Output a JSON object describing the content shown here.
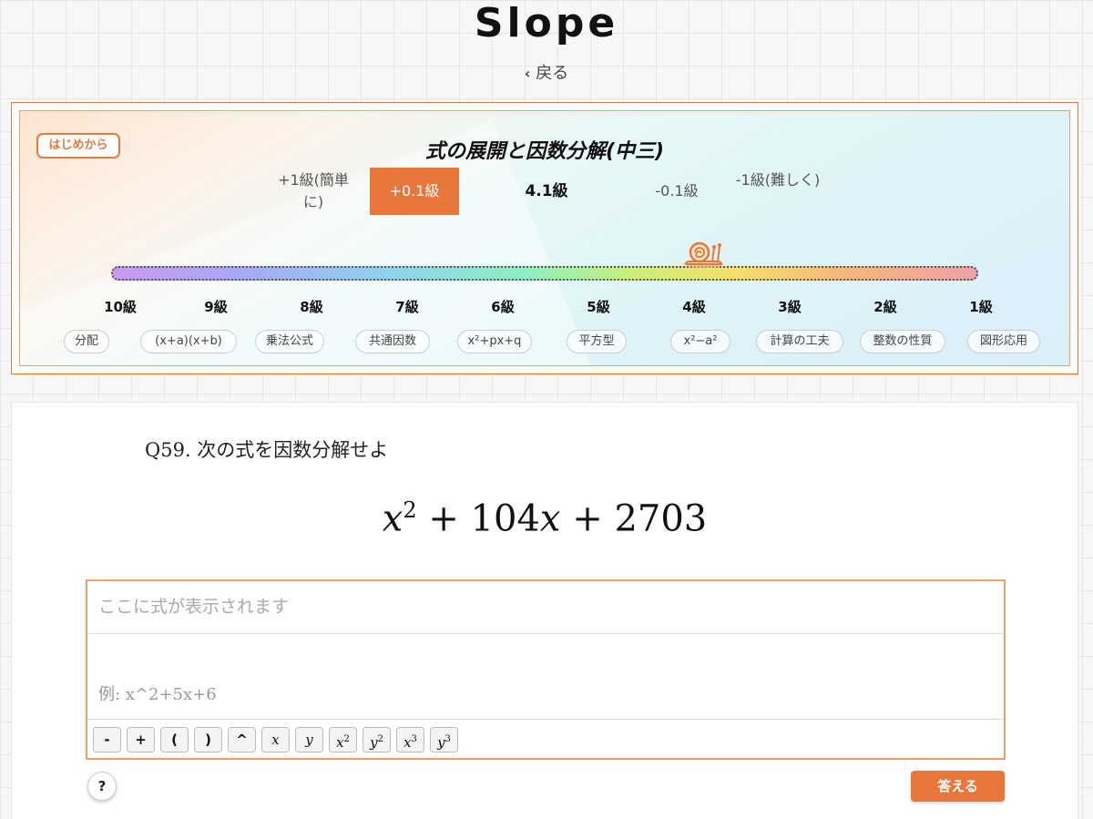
{
  "app": {
    "title": "Slope",
    "back_label": "戻る"
  },
  "panel": {
    "restart_label": "はじめから",
    "unit_title": "式の展開と因数分解(中三)",
    "steps": {
      "plus1": "+1級(簡単に)",
      "plus01": "+0.1級",
      "current": "4.1級",
      "minus01": "-0.1級",
      "minus1": "-1級(難しく)"
    },
    "current_level": 4.1,
    "levels": [
      "10級",
      "9級",
      "8級",
      "7級",
      "6級",
      "5級",
      "4級",
      "3級",
      "2級",
      "1級"
    ],
    "topics": [
      "分配",
      "(x+a)(x+b)",
      "乗法公式",
      "共通因数",
      "x²+px+q",
      "平方型",
      "x²−a²",
      "計算の工夫",
      "整数の性質",
      "図形応用"
    ]
  },
  "question": {
    "label": "Q59. 次の式を因数分解せよ",
    "expr": {
      "term1_var": "x",
      "term1_exp": "2",
      "op1": "+",
      "term2": "104",
      "term2_var": "x",
      "op2": "+",
      "term3": "2703"
    }
  },
  "answer": {
    "preview_placeholder": "ここに式が表示されます",
    "input_placeholder": "例: x^2+5x+6",
    "input_value": ""
  },
  "keypad": {
    "keys": [
      {
        "label": "-",
        "style": "op"
      },
      {
        "label": "+",
        "style": "op"
      },
      {
        "label": "(",
        "style": "op"
      },
      {
        "label": ")",
        "style": "op"
      },
      {
        "label": "^",
        "style": "op"
      },
      {
        "label": "x",
        "style": "var"
      },
      {
        "label": "y",
        "style": "var"
      },
      {
        "label": "x",
        "sup": "2",
        "style": "var"
      },
      {
        "label": "y",
        "sup": "2",
        "style": "var"
      },
      {
        "label": "x",
        "sup": "3",
        "style": "var"
      },
      {
        "label": "y",
        "sup": "3",
        "style": "var"
      }
    ]
  },
  "footer": {
    "help_label": "?",
    "submit_label": "答える"
  },
  "colors": {
    "accent": "#e8773c",
    "border": "#e07a3f"
  }
}
